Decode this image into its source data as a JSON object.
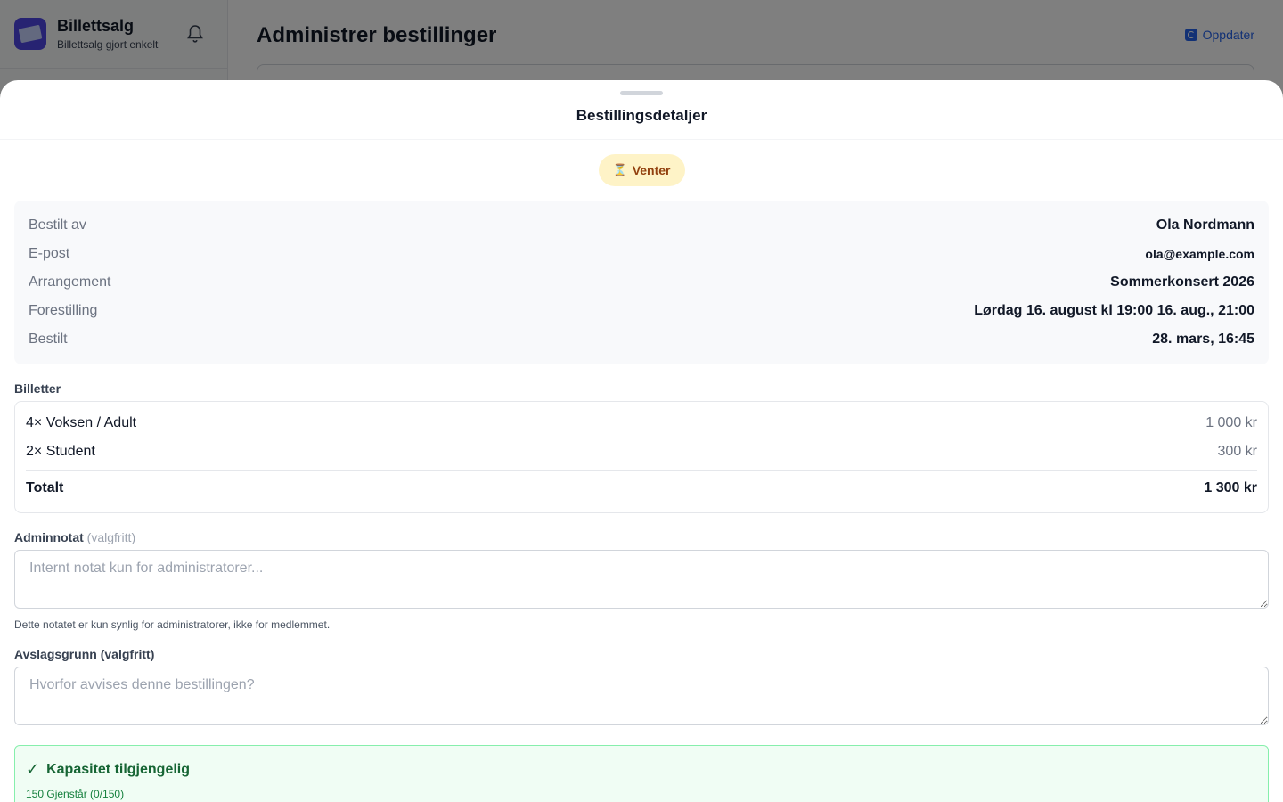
{
  "app": {
    "name": "Billettsalg",
    "tagline": "Billettsalg gjort enkelt"
  },
  "header": {
    "title": "Administrer bestillinger",
    "refresh_label": "Oppdater"
  },
  "sheet": {
    "title": "Bestillingsdetaljer",
    "status": {
      "icon": "hourglass-icon",
      "glyph": "⏳",
      "label": "Venter",
      "color": "#fef3c7"
    },
    "details": [
      {
        "label": "Bestilt av",
        "value": "Ola Nordmann"
      },
      {
        "label": "E-post",
        "value": "ola@example.com"
      },
      {
        "label": "Arrangement",
        "value": "Sommerkonsert 2026"
      },
      {
        "label": "Forestilling",
        "value": "Lørdag 16. august kl 19:00 16. aug., 21:00"
      },
      {
        "label": "Bestilt",
        "value": "28. mars, 16:45"
      }
    ],
    "tickets": {
      "heading": "Billetter",
      "items": [
        {
          "label": "4× Voksen / Adult",
          "amount": "1 000 kr"
        },
        {
          "label": "2× Student",
          "amount": "300 kr"
        }
      ],
      "total_label": "Totalt",
      "total_amount": "1 300 kr"
    },
    "admin_note": {
      "label": "Adminnotat",
      "optional": "(valgfritt)",
      "placeholder": "Internt notat kun for administratorer...",
      "value": "",
      "hint": "Dette notatet er kun synlig for administratorer, ikke for medlemmet."
    },
    "rejection": {
      "label": "Avslagsgrunn (valgfritt)",
      "placeholder": "Hvorfor avvises denne bestillingen?",
      "value": ""
    },
    "capacity": {
      "glyph": "✓",
      "title": "Kapasitet tilgjengelig",
      "subtitle": "150 Gjenstår (0/150)",
      "color": "#f0fdf4"
    }
  }
}
